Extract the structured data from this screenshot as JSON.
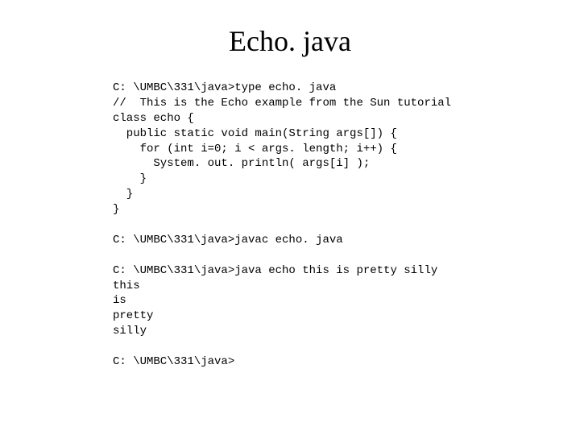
{
  "title": "Echo. java",
  "code": "C: \\UMBC\\331\\java>type echo. java\n//  This is the Echo example from the Sun tutorial\nclass echo {\n  public static void main(String args[]) {\n    for (int i=0; i < args. length; i++) {\n      System. out. println( args[i] );\n    }\n  }\n}\n\nC: \\UMBC\\331\\java>javac echo. java\n\nC: \\UMBC\\331\\java>java echo this is pretty silly\nthis\nis\npretty\nsilly\n\nC: \\UMBC\\331\\java>"
}
